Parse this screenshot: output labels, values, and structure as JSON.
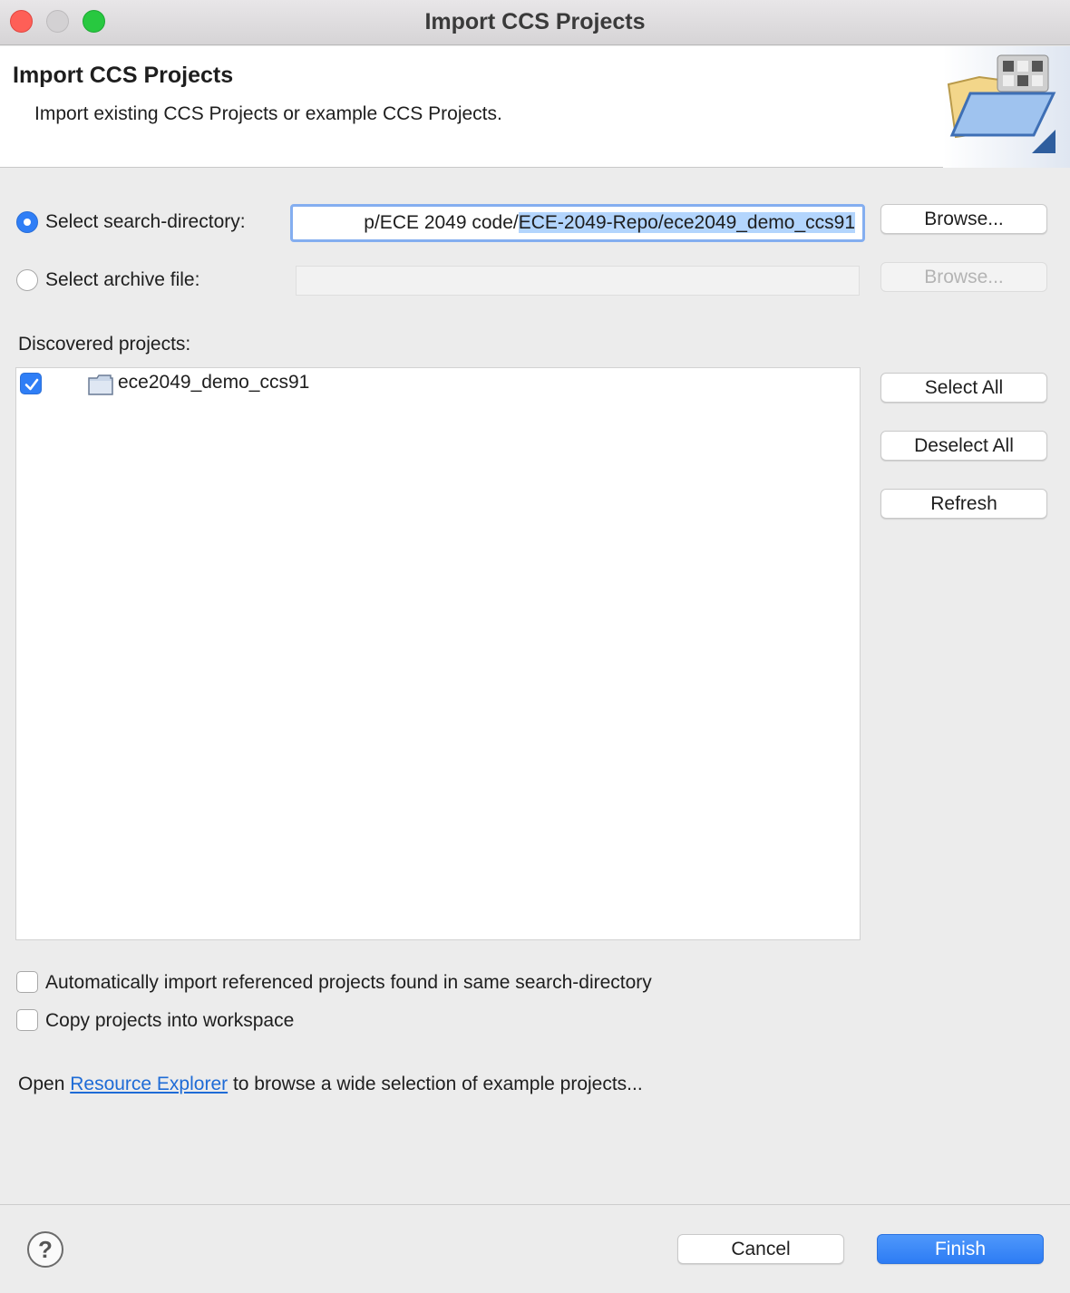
{
  "window": {
    "title": "Import CCS Projects"
  },
  "header": {
    "title": "Import CCS Projects",
    "description": "Import existing CCS Projects or example CCS Projects."
  },
  "source": {
    "search_dir_label": "Select search-directory:",
    "search_dir_value_prefix": "p/ECE 2049 code/",
    "search_dir_value_selected": "ECE-2049-Repo/ece2049_demo_ccs91",
    "search_dir_selected": true,
    "archive_label": "Select archive file:",
    "archive_value": "",
    "archive_selected": false,
    "browse_label": "Browse...",
    "archive_browse_label": "Browse..."
  },
  "projects": {
    "label": "Discovered projects:",
    "items": [
      {
        "name": "ece2049_demo_ccs91",
        "checked": true,
        "icon": "project-folder-icon"
      }
    ],
    "select_all_label": "Select All",
    "deselect_all_label": "Deselect All",
    "refresh_label": "Refresh"
  },
  "options": {
    "auto_import_label": "Automatically import referenced projects found in same search-directory",
    "auto_import_checked": false,
    "copy_label": "Copy projects into workspace",
    "copy_checked": false
  },
  "resource_explorer": {
    "prefix": "Open ",
    "link": "Resource Explorer",
    "suffix": " to browse a wide selection of example projects..."
  },
  "footer": {
    "help_icon": "?",
    "cancel_label": "Cancel",
    "finish_label": "Finish"
  },
  "colors": {
    "accent": "#2f7ef6",
    "link": "#1e6bd6",
    "selection": "#b3d5fd"
  }
}
